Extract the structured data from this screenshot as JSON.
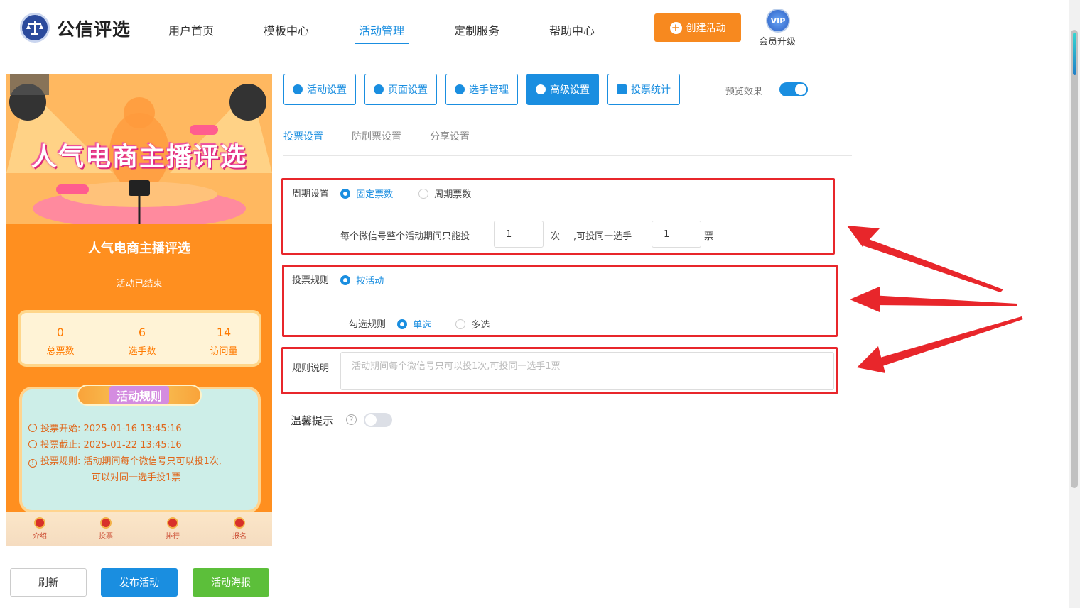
{
  "header": {
    "brand": "公信评选",
    "nav": [
      "用户首页",
      "模板中心",
      "活动管理",
      "定制服务",
      "帮助中心"
    ],
    "active_nav": "活动管理",
    "create_button": "创建活动",
    "vip_badge": "VIP",
    "vip_label": "会员升级"
  },
  "preview": {
    "banner_title": "人气电商主播评选",
    "title": "人气电商主播评选",
    "status": "活动已结束",
    "stats": [
      {
        "value": "0",
        "label": "总票数"
      },
      {
        "value": "6",
        "label": "选手数"
      },
      {
        "value": "14",
        "label": "访问量"
      }
    ],
    "rules_heading": "活动规则",
    "rules": [
      {
        "label": "投票开始:",
        "value": "2025-01-16 13:45:16"
      },
      {
        "label": "投票截止:",
        "value": "2025-01-22 13:45:16"
      },
      {
        "label": "投票规则:",
        "value": "活动期间每个微信号只可以投1次,"
      },
      {
        "label": "",
        "value": "可以对同一选手投1票"
      }
    ],
    "bottom_nav": [
      "介绍",
      "投票",
      "排行",
      "报名"
    ]
  },
  "actions": {
    "refresh": "刷新",
    "publish": "发布活动",
    "poster": "活动海报"
  },
  "tabs": [
    {
      "label": "活动设置",
      "icon": "star-icon"
    },
    {
      "label": "页面设置",
      "icon": "gear-icon"
    },
    {
      "label": "选手管理",
      "icon": "users-icon"
    },
    {
      "label": "高级设置",
      "icon": "settings-sliders-icon"
    },
    {
      "label": "投票统计",
      "icon": "bar-chart-icon"
    }
  ],
  "active_tab": "高级设置",
  "preview_toggle": {
    "label": "预览效果",
    "on": true
  },
  "subtabs": [
    "投票设置",
    "防刷票设置",
    "分享设置"
  ],
  "active_subtab": "投票设置",
  "cycle": {
    "label": "周期设置",
    "options": [
      "固定票数",
      "周期票数"
    ],
    "selected": "固定票数",
    "sentence_prefix": "每个微信号整个活动期间只能投",
    "votes_value": "1",
    "unit_times": "次",
    "sentence_mid": ",可投同一选手",
    "per_player_value": "1",
    "unit_votes": "票"
  },
  "vote_rule": {
    "label": "投票规则",
    "option": "按活动",
    "check_label": "勾选规则",
    "check_options": [
      "单选",
      "多选"
    ],
    "check_selected": "单选"
  },
  "rule_desc": {
    "label": "规则说明",
    "placeholder": "活动期间每个微信号只可以投1次,可投同一选手1票"
  },
  "tip": {
    "label": "温馨提示",
    "on": false
  },
  "colors": {
    "primary": "#1a8ee0",
    "orange": "#f7891f",
    "green": "#5cbf3a",
    "highlight": "#e8262b"
  }
}
